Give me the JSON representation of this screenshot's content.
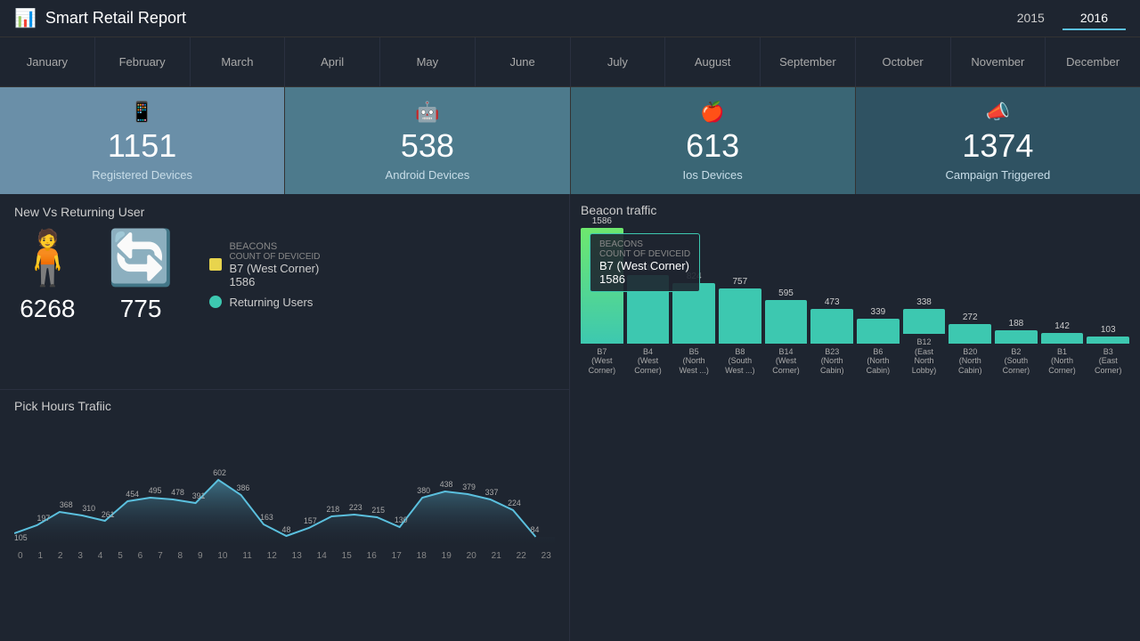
{
  "header": {
    "title": "Smart Retail Report",
    "logo_icon": "📊",
    "years": [
      "2015",
      "2016"
    ],
    "active_year": "2016"
  },
  "months": [
    {
      "label": "January",
      "active": false
    },
    {
      "label": "February",
      "active": false
    },
    {
      "label": "March",
      "active": false
    },
    {
      "label": "April",
      "active": false
    },
    {
      "label": "May",
      "active": false
    },
    {
      "label": "June",
      "active": false
    },
    {
      "label": "July",
      "active": false
    },
    {
      "label": "August",
      "active": false
    },
    {
      "label": "September",
      "active": false
    },
    {
      "label": "October",
      "active": false
    },
    {
      "label": "November",
      "active": false
    },
    {
      "label": "December",
      "active": false
    }
  ],
  "kpis": [
    {
      "icon": "📱",
      "value": "1151",
      "label": "Registered Devices"
    },
    {
      "icon": "🤖",
      "value": "538",
      "label": "Android Devices"
    },
    {
      "icon": "",
      "value": "613",
      "label": "Ios Devices"
    },
    {
      "icon": "📣",
      "value": "1374",
      "label": "Campaign Triggered"
    }
  ],
  "nvr": {
    "title": "New Vs Returning User",
    "new_count": "6268",
    "returning_count": "775",
    "legend": {
      "beacon_label": "BEACONS",
      "beacon_sub_label": "COUNT OF DEVICEID",
      "beacon_value": "1586",
      "beacon_name": "B7 (West Corner)",
      "returning_label": "Returning Users"
    }
  },
  "beacon": {
    "title": "Beacon traffic",
    "bars": [
      {
        "label": "B7\n(West\nCorner)",
        "value": 1586,
        "highlighted": true
      },
      {
        "label": "B4\n(West\nCorner)",
        "value": 945,
        "highlighted": false
      },
      {
        "label": "B5\n(North\nWest ...)",
        "value": 824,
        "highlighted": false
      },
      {
        "label": "B8\n(South\nWest ...)",
        "value": 757,
        "highlighted": false
      },
      {
        "label": "B14\n(West\nCorner)",
        "value": 595,
        "highlighted": false
      },
      {
        "label": "B23\n(North\nCabin)",
        "value": 473,
        "highlighted": false
      },
      {
        "label": "B6\n(North\nCabin)",
        "value": 339,
        "highlighted": false
      },
      {
        "label": "B12\n(East\nNorth Lobby)",
        "value": 338,
        "highlighted": false
      },
      {
        "label": "B20\n(North\nCabin)",
        "value": 272,
        "highlighted": false
      },
      {
        "label": "B2\n(South\nCorner)",
        "value": 188,
        "highlighted": false
      },
      {
        "label": "B1\n(North\nCorner)",
        "value": 142,
        "highlighted": false
      },
      {
        "label": "B3\n(East\nCorner)",
        "value": 103,
        "highlighted": false
      }
    ]
  },
  "peak": {
    "title": "Pick Hours Trafiic",
    "data": [
      105,
      197,
      368,
      310,
      261,
      454,
      495,
      478,
      391,
      602,
      386,
      163,
      48,
      157,
      218,
      223,
      215,
      130,
      380,
      438,
      379,
      337,
      224,
      84
    ],
    "x_labels": [
      "0",
      "1",
      "2",
      "3",
      "4",
      "5",
      "6",
      "7",
      "8",
      "9",
      "10",
      "11",
      "12",
      "13",
      "14",
      "15",
      "16",
      "17",
      "18",
      "19",
      "20",
      "21",
      "22",
      "23"
    ]
  }
}
